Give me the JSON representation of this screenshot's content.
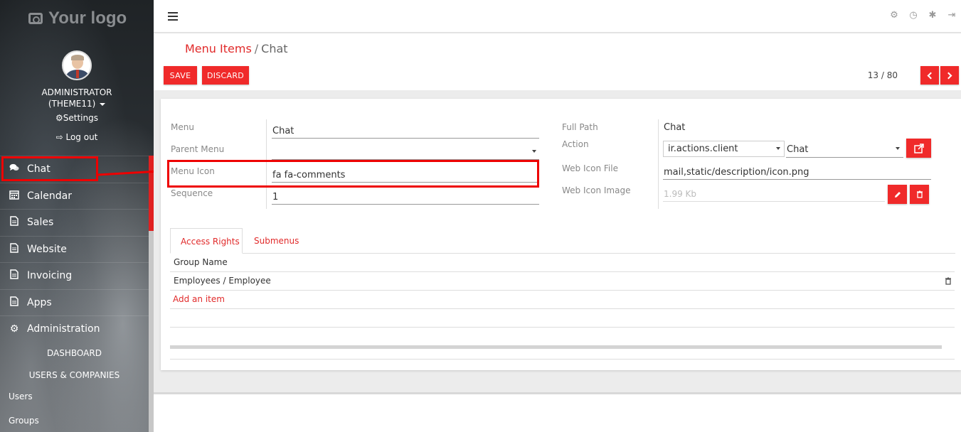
{
  "sidebar": {
    "logo_text": "Your logo",
    "user": {
      "name_line1": "ADMINISTRATOR",
      "name_line2": "(THEME11)"
    },
    "settings_label": "Settings",
    "logout_label": "Log out",
    "menu": [
      {
        "label": "Chat",
        "icon": "comments-icon",
        "active": true
      },
      {
        "label": "Calendar",
        "icon": "calendar-icon"
      },
      {
        "label": "Sales",
        "icon": "file-icon"
      },
      {
        "label": "Website",
        "icon": "file-icon"
      },
      {
        "label": "Invoicing",
        "icon": "file-icon"
      },
      {
        "label": "Apps",
        "icon": "file-icon"
      },
      {
        "label": "Administration",
        "icon": "gear-icon"
      }
    ],
    "submenu": {
      "dashboard": "DASHBOARD",
      "users_companies": "USERS & COMPANIES",
      "users": "Users",
      "groups": "Groups"
    }
  },
  "topbar": {
    "icons": [
      "gear-icon",
      "clock-icon",
      "bug-icon",
      "sign-out-icon"
    ]
  },
  "control": {
    "breadcrumb": {
      "parent": "Menu Items",
      "separator": "/",
      "current": "Chat"
    },
    "save_label": "SAVE",
    "discard_label": "DISCARD",
    "pager": "13 / 80"
  },
  "form": {
    "menu_label": "Menu",
    "menu_value": "Chat",
    "parent_menu_label": "Parent Menu",
    "parent_menu_value": "",
    "menu_icon_label": "Menu Icon",
    "menu_icon_value": "fa fa-comments",
    "sequence_label": "Sequence",
    "sequence_value": "1",
    "full_path_label": "Full Path",
    "full_path_value": "Chat",
    "action_label": "Action",
    "action_model": "ir.actions.client",
    "action_value": "Chat",
    "web_icon_file_label": "Web Icon File",
    "web_icon_file_value": "mail,static/description/icon.png",
    "web_icon_image_label": "Web Icon Image",
    "web_icon_image_value": "1.99 Kb"
  },
  "tabs": {
    "access_rights": "Access Rights",
    "submenus": "Submenus"
  },
  "table": {
    "header": "Group Name",
    "rows": [
      "Employees / Employee"
    ],
    "add_item": "Add an item"
  },
  "colors": {
    "accent": "#f02a2a",
    "highlight": "#e00000",
    "sidebar_text": "#ffffff"
  }
}
